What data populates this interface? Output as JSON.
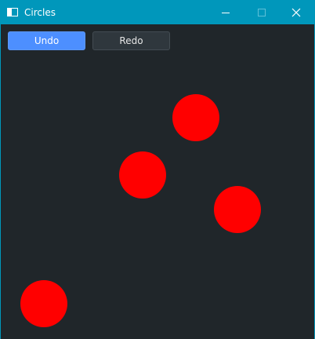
{
  "window": {
    "title": "Circles",
    "accent_color": "#0097bb",
    "background_color": "#20262a"
  },
  "toolbar": {
    "undo_label": "Undo",
    "redo_label": "Redo"
  },
  "canvas": {
    "circle_color": "#ff0000",
    "circle_count": 4
  }
}
